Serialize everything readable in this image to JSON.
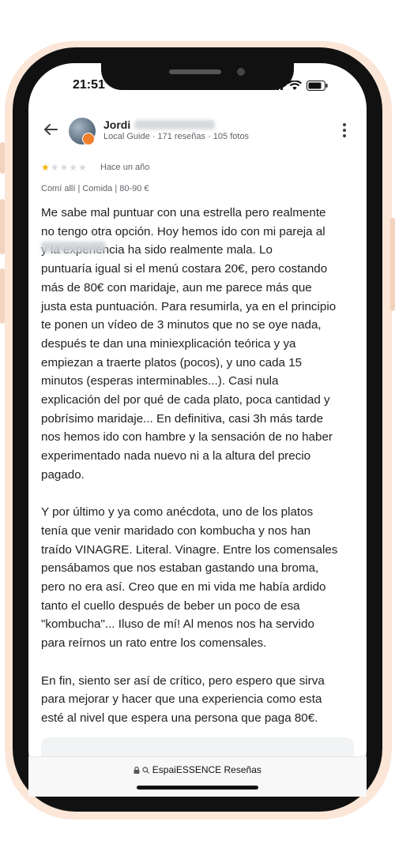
{
  "status_bar": {
    "time": "21:51"
  },
  "header": {
    "name": "Jordi",
    "subtitle": "Local Guide · 171 reseñas · 105 fotos"
  },
  "review": {
    "rating": 1,
    "date": "Hace un año",
    "meta": "Comí allí  |  Comida  |  80-90 €",
    "text": "Me sabe mal puntuar con una estrella pero realmente\nno tengo otra opción. Hoy hemos ido con mi pareja al\n                      y la experiencia ha sido realmente mala. Lo\npuntuaría igual si el menú costara 20€, pero costando\nmás de 80€ con maridaje, aun me parece más que\njusta esta puntuación. Para resumirla, ya en el principio\nte ponen un vídeo de 3 minutos que no se oye nada,\ndespués te dan una miniexplicación teórica y ya\nempiezan a traerte platos (pocos), y uno cada 15\nminutos (esperas interminables...). Casi nula\nexplicación del por qué de cada plato, poca cantidad y\npobrísimo maridaje... En definitiva, casi 3h más tarde\nnos hemos ido con hambre y la sensación de no haber\nexperimentado nada nuevo ni a la altura del precio\npagado.\n\nY por último y ya como anécdota, uno de los platos\ntenía que venir maridado con kombucha y nos han\ntraído VINAGRE. Literal. Vinagre. Entre los comensales\npensábamos que nos estaban gastando una broma,\npero no era así. Creo que en mi vida me había ardido\ntanto el cuello después de beber un poco de esa\n\"kombucha\"... Iluso de mí! Al menos nos ha servido\npara reírnos un rato entre los comensales.\n\nEn fin, siento ser así de crítico, pero espero que sirva\npara mejorar y hacer que una experiencia como esta\nesté al nivel que espera una persona que paga 80€."
  },
  "browser": {
    "url": "EspaiESSENCE Reseñas"
  },
  "icons": {
    "back": "back-arrow-icon",
    "more": "more-vert-icon",
    "lock": "lock-icon",
    "search": "search-icon",
    "signal": "signal-icon",
    "wifi": "wifi-icon",
    "battery": "battery-icon"
  },
  "colors": {
    "star": "#f4b400",
    "frame": "#fbe6d8",
    "badge": "#f07f2b"
  }
}
